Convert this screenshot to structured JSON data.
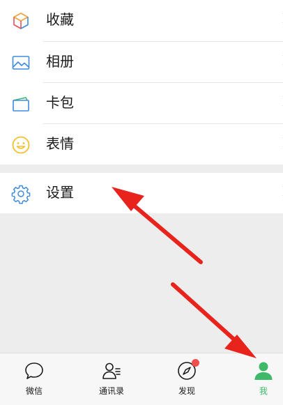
{
  "menu": {
    "items": [
      {
        "label": "收藏",
        "icon": "favorites-cube-icon"
      },
      {
        "label": "相册",
        "icon": "album-picture-icon"
      },
      {
        "label": "卡包",
        "icon": "card-wallet-icon"
      },
      {
        "label": "表情",
        "icon": "sticker-smiley-icon"
      }
    ],
    "settings": {
      "label": "设置",
      "icon": "gear-icon"
    }
  },
  "tab_bar": {
    "tabs": [
      {
        "label": "微信",
        "icon": "chat-bubble-icon",
        "active": false
      },
      {
        "label": "通讯录",
        "icon": "contacts-icon",
        "active": false
      },
      {
        "label": "发现",
        "icon": "compass-icon",
        "active": false,
        "badge": "dot"
      },
      {
        "label": "我",
        "icon": "person-icon",
        "active": true
      }
    ]
  },
  "colors": {
    "active_green": "#3fb86a",
    "annotation_red": "#e8231c",
    "badge_red": "#f05050",
    "icon_blue": "#3d8be0"
  }
}
